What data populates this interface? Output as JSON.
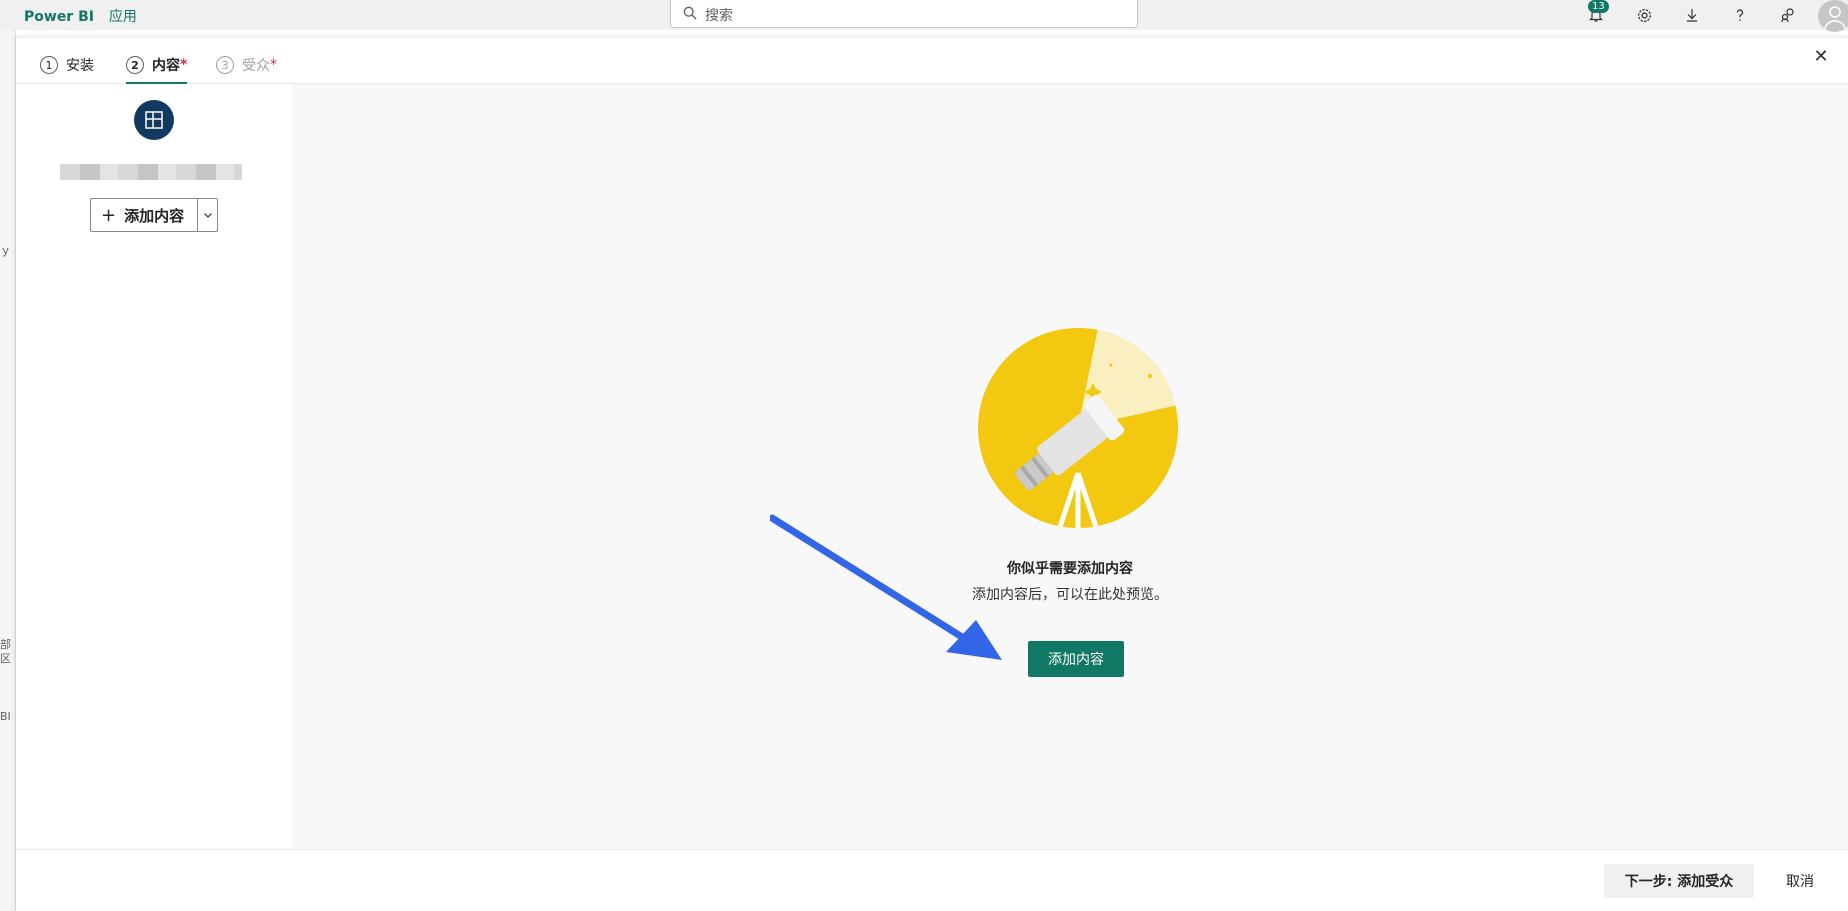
{
  "topbar": {
    "brand": "Power BI",
    "app_link": "应用",
    "search_placeholder": "搜索",
    "notification_count": "13"
  },
  "background_left": {
    "fragments": [
      "ｙ",
      "部",
      "区",
      "BI"
    ]
  },
  "wizard": {
    "steps": [
      {
        "num": "1",
        "label": "安装",
        "required": ""
      },
      {
        "num": "2",
        "label": "内容",
        "required": "*"
      },
      {
        "num": "3",
        "label": "受众",
        "required": "*"
      }
    ],
    "close_label": "✕"
  },
  "sidebar": {
    "add_content_label": "添加内容"
  },
  "empty_state": {
    "title": "你似乎需要添加内容",
    "subtitle": "添加内容后，可以在此处预览。",
    "button_label": "添加内容"
  },
  "footer": {
    "next_label": "下一步: 添加受众",
    "cancel_label": "取消"
  },
  "colors": {
    "accent": "#117865",
    "workspace_icon": "#12395f",
    "annotation_arrow": "#3366e6",
    "illustration_yellow": "#f2c811"
  }
}
